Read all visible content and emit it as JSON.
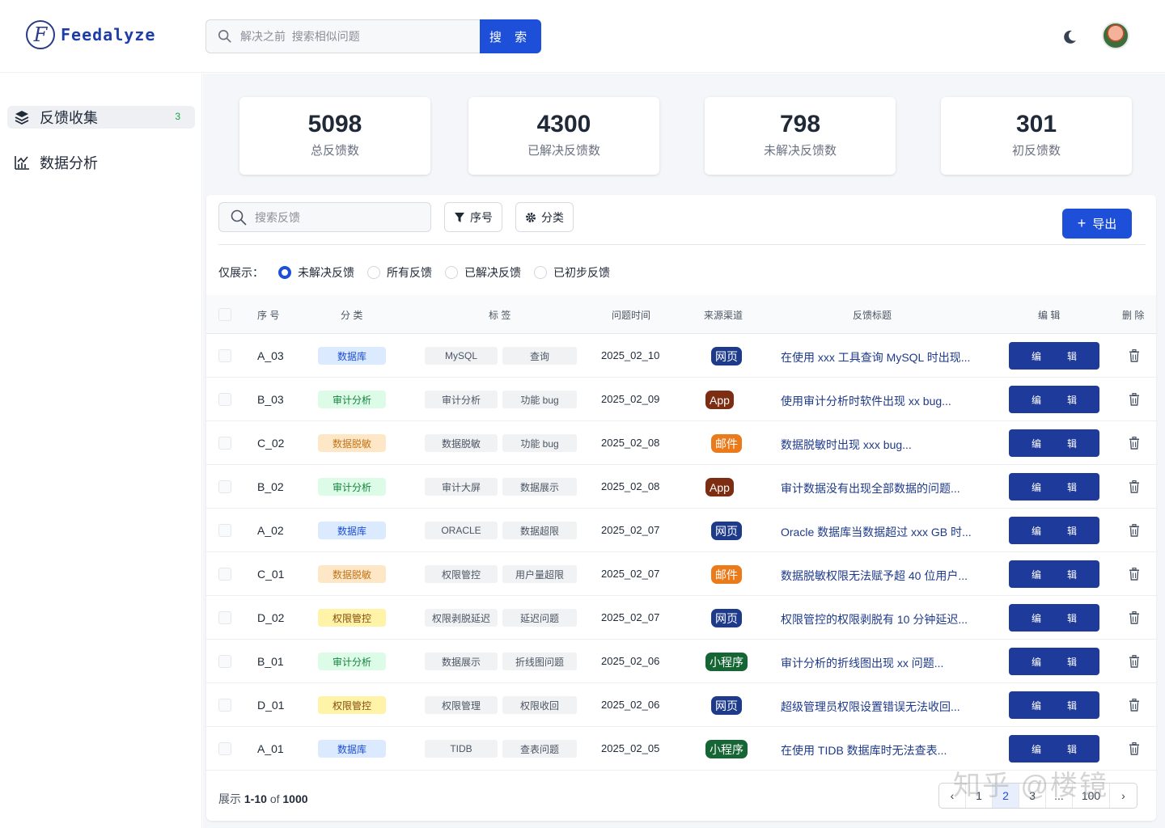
{
  "app": {
    "logo_letter": "F",
    "name": "Feedalyze"
  },
  "header": {
    "search_placeholder": "解决之前  搜索相似问题",
    "search_button": "搜 索"
  },
  "sidebar": {
    "items": [
      {
        "label": "反馈收集",
        "badge": "3",
        "icon": "layers-icon",
        "active": true
      },
      {
        "label": "数据分析",
        "icon": "chart-icon",
        "active": false
      }
    ]
  },
  "stats": [
    {
      "value": "5098",
      "label": "总反馈数"
    },
    {
      "value": "4300",
      "label": "已解决反馈数"
    },
    {
      "value": "798",
      "label": "未解决反馈数"
    },
    {
      "value": "301",
      "label": "初反馈数"
    }
  ],
  "toolbar": {
    "search_placeholder": "搜索反馈",
    "sort_label": "序号",
    "category_label": "分类",
    "export_label": "导出"
  },
  "filter": {
    "prefix": "仅展示：",
    "options": [
      "未解决反馈",
      "所有反馈",
      "已解决反馈",
      "已初步反馈"
    ],
    "selected": 0
  },
  "table": {
    "headers": [
      "序 号",
      "分 类",
      "标 签",
      "问题时间",
      "来源渠道",
      "反馈标题",
      "编 辑",
      "删 除"
    ],
    "edit_label": [
      "编",
      "辑"
    ],
    "rows": [
      {
        "code": "A_03",
        "category": "数据库",
        "tags": [
          "MySQL",
          "查询"
        ],
        "date": "2025_02_10",
        "source": "网页",
        "title": "在使用 xxx 工具查询 MySQL 时出现..."
      },
      {
        "code": "B_03",
        "category": "审计分析",
        "tags": [
          "审计分析",
          "功能 bug"
        ],
        "date": "2025_02_09",
        "source": "App",
        "title": "使用审计分析时软件出现 xx bug..."
      },
      {
        "code": "C_02",
        "category": "数据脱敏",
        "tags": [
          "数据脱敏",
          "功能 bug"
        ],
        "date": "2025_02_08",
        "source": "邮件",
        "title": "数据脱敏时出现 xxx bug..."
      },
      {
        "code": "B_02",
        "category": "审计分析",
        "tags": [
          "审计大屏",
          "数据展示"
        ],
        "date": "2025_02_08",
        "source": "App",
        "title": "审计数据没有出现全部数据的问题..."
      },
      {
        "code": "A_02",
        "category": "数据库",
        "tags": [
          "ORACLE",
          "数据超限"
        ],
        "date": "2025_02_07",
        "source": "网页",
        "title": "Oracle 数据库当数据超过 xxx GB 时..."
      },
      {
        "code": "C_01",
        "category": "数据脱敏",
        "tags": [
          "权限管控",
          "用户量超限"
        ],
        "date": "2025_02_07",
        "source": "邮件",
        "title": "数据脱敏权限无法赋予超 40 位用户..."
      },
      {
        "code": "D_02",
        "category": "权限管控",
        "tags": [
          "权限剥脱延迟",
          "延迟问题"
        ],
        "date": "2025_02_07",
        "source": "网页",
        "title": "权限管控的权限剥脱有 10 分钟延迟..."
      },
      {
        "code": "B_01",
        "category": "审计分析",
        "tags": [
          "数据展示",
          "折线图问题"
        ],
        "date": "2025_02_06",
        "source": "小程序",
        "title": "审计分析的折线图出现 xx 问题..."
      },
      {
        "code": "D_01",
        "category": "权限管控",
        "tags": [
          "权限管理",
          "权限收回"
        ],
        "date": "2025_02_06",
        "source": "网页",
        "title": "超级管理员权限设置错误无法收回..."
      },
      {
        "code": "A_01",
        "category": "数据库",
        "tags": [
          "TIDB",
          "查表问题"
        ],
        "date": "2025_02_05",
        "source": "小程序",
        "title": "在使用 TIDB 数据库时无法查表..."
      }
    ]
  },
  "category_colors": {
    "数据库": {
      "bg": "#dbeafe",
      "fg": "#1d4ed8"
    },
    "审计分析": {
      "bg": "#dcfce7",
      "fg": "#15803d"
    },
    "数据脱敏": {
      "bg": "#fde7c7",
      "fg": "#c2741a"
    },
    "权限管控": {
      "bg": "#fef3a7",
      "fg": "#854d0e"
    }
  },
  "source_colors": {
    "网页": "#1e3a8a",
    "App": "#7c2d12",
    "邮件": "#ea7a1a",
    "小程序": "#166534"
  },
  "footer": {
    "prefix": "展示",
    "range": "1-10",
    "of": "of",
    "total": "1000"
  },
  "pagination": {
    "pages": [
      "1",
      "2",
      "3",
      "...",
      "100"
    ],
    "current": "2"
  },
  "watermark": "知乎 @楼镜"
}
